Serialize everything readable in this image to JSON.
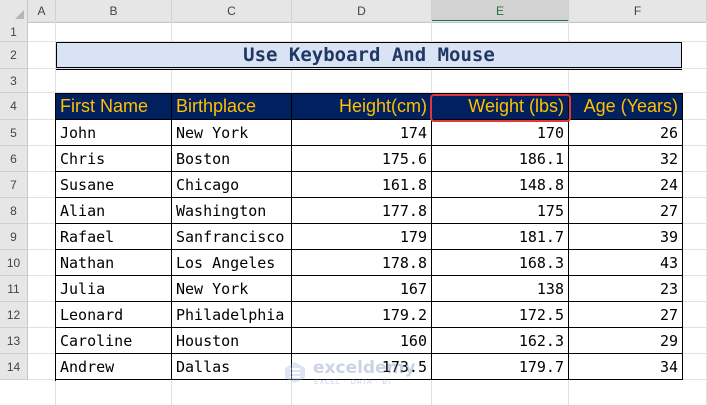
{
  "columns": [
    "A",
    "B",
    "C",
    "D",
    "E",
    "F"
  ],
  "selected_column": "E",
  "rows": [
    "1",
    "2",
    "3",
    "4",
    "5",
    "6",
    "7",
    "8",
    "9",
    "10",
    "11",
    "12",
    "13",
    "14"
  ],
  "title": "Use  Keyboard And  Mouse",
  "headers": {
    "first_name": "First Name",
    "birthplace": "Birthplace",
    "height": "Height(cm)",
    "weight": "Weight (lbs)",
    "age": "Age (Years)"
  },
  "table": [
    {
      "first_name": "John",
      "birthplace": "New York",
      "height": "174",
      "weight": "170",
      "age": "26"
    },
    {
      "first_name": "Chris",
      "birthplace": "Boston",
      "height": "175.6",
      "weight": "186.1",
      "age": "32"
    },
    {
      "first_name": "Susane",
      "birthplace": "Chicago",
      "height": "161.8",
      "weight": "148.8",
      "age": "24"
    },
    {
      "first_name": "Alian",
      "birthplace": "Washington",
      "height": "177.8",
      "weight": "175",
      "age": "27"
    },
    {
      "first_name": "Rafael",
      "birthplace": "Sanfrancisco",
      "height": "179",
      "weight": "181.7",
      "age": "39"
    },
    {
      "first_name": "Nathan",
      "birthplace": "Los Angeles",
      "height": "178.8",
      "weight": "168.3",
      "age": "43"
    },
    {
      "first_name": "Julia",
      "birthplace": "New York",
      "height": "167",
      "weight": "138",
      "age": "23"
    },
    {
      "first_name": "Leonard",
      "birthplace": "Philadelphia",
      "height": "179.2",
      "weight": "172.5",
      "age": "27"
    },
    {
      "first_name": "Caroline",
      "birthplace": "Houston",
      "height": "160",
      "weight": "162.3",
      "age": "29"
    },
    {
      "first_name": "Andrew",
      "birthplace": "Dallas",
      "height": "173.5",
      "weight": "179.7",
      "age": "34"
    }
  ],
  "watermark": {
    "name": "exceldemy",
    "tagline": "EXCEL · DATA · BI"
  },
  "colors": {
    "header_bg": "#002060",
    "header_text": "#ffc000",
    "title_bg": "#dae3f3",
    "title_text": "#1f3864",
    "highlight": "#e0373c",
    "selected_col": "#217346"
  }
}
